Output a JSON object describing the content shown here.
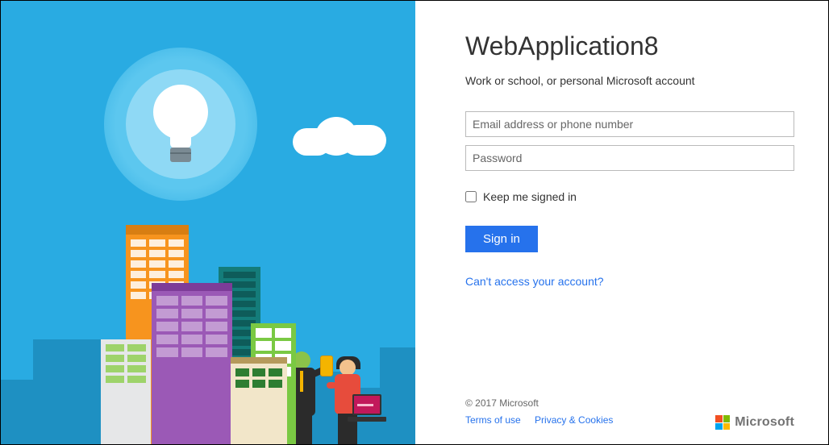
{
  "app": {
    "title": "WebApplication8",
    "subtitle": "Work or school, or personal Microsoft account"
  },
  "form": {
    "email_value": "",
    "email_placeholder": "Email address or phone number",
    "password_value": "",
    "password_placeholder": "Password",
    "remember_label": "Keep me signed in",
    "signin_label": "Sign in",
    "access_link": "Can't access your account?"
  },
  "footer": {
    "copyright": "© 2017 Microsoft",
    "terms": "Terms of use",
    "privacy": "Privacy & Cookies",
    "brand": "Microsoft"
  }
}
